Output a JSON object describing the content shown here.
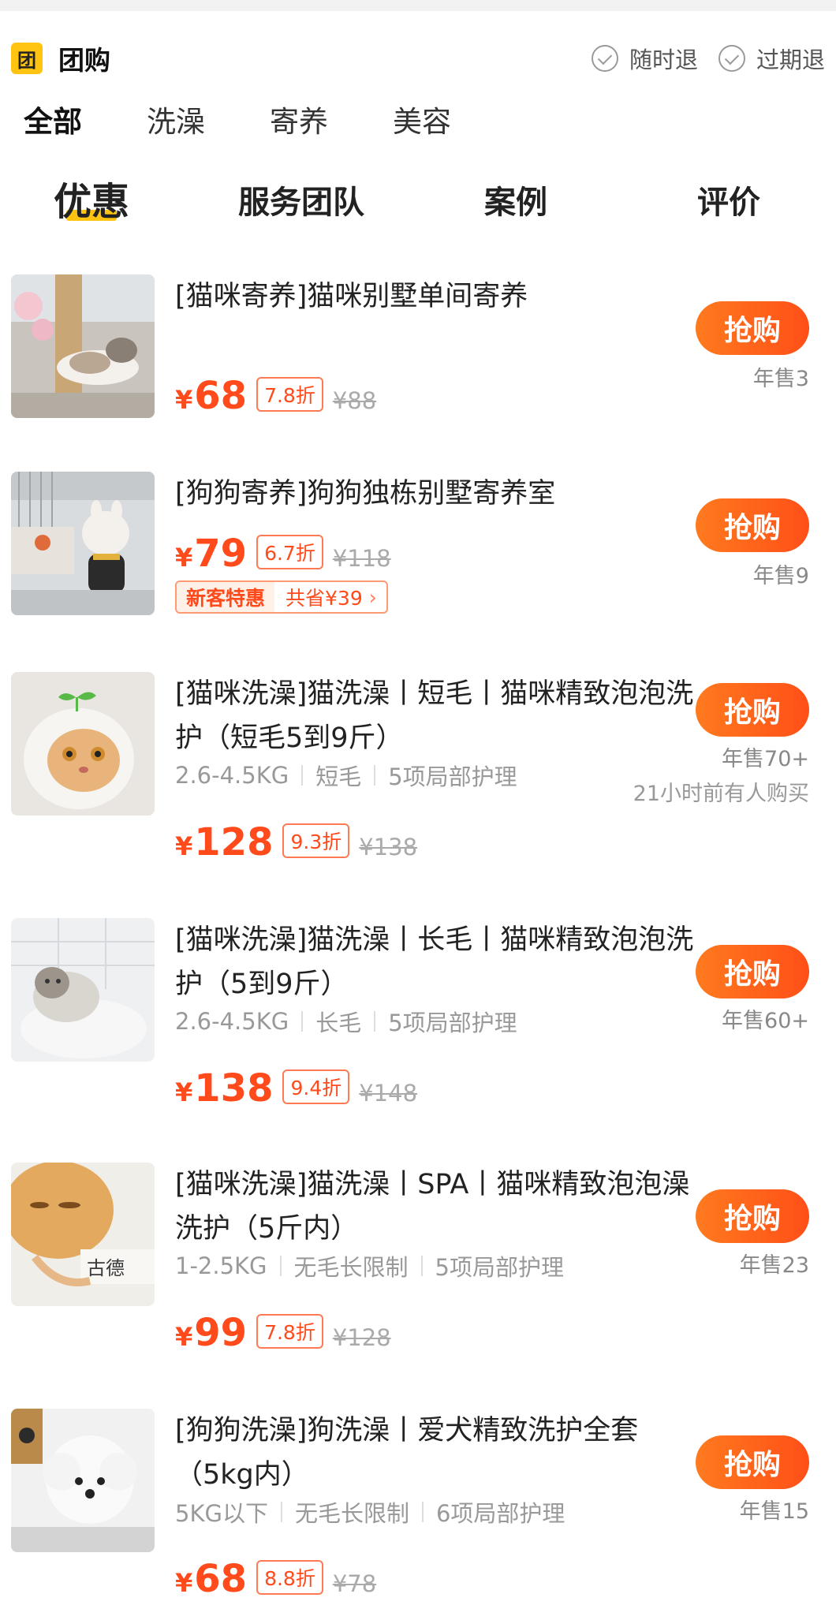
{
  "header": {
    "logo": "团",
    "title": "团购",
    "guarantees": [
      "随时退",
      "过期退"
    ]
  },
  "category_tabs": [
    "全部",
    "洗澡",
    "寄养",
    "美容"
  ],
  "section_tabs": [
    "优惠",
    "服务团队",
    "案例",
    "评价"
  ],
  "products": [
    {
      "title": "[猫咪寄养]猫咪别墅单间寄养",
      "specs": [],
      "price": "68",
      "currency": "¥",
      "discount": "7.8折",
      "original": "¥88",
      "buy_label": "抢购",
      "sales": "年售3",
      "thumb_icon": "cat-on-scratching-post-photo"
    },
    {
      "title": "[狗狗寄养]狗狗独栋别墅寄养室",
      "specs": [],
      "price": "79",
      "currency": "¥",
      "discount": "6.7折",
      "original": "¥118",
      "promo_tag": "新客特惠",
      "promo_save": "共省¥39",
      "promo_chevron": "›",
      "buy_label": "抢购",
      "sales": "年售9",
      "thumb_icon": "french-bulldog-photo"
    },
    {
      "title": "[猫咪洗澡]猫洗澡丨短毛丨猫咪精致泡泡洗护（短毛5到9斤）",
      "specs": [
        "2.6-4.5KG",
        "短毛",
        "5项局部护理"
      ],
      "price": "128",
      "currency": "¥",
      "discount": "9.3折",
      "original": "¥138",
      "buy_label": "抢购",
      "sales": "年售70+",
      "recent": "21小时前有人购买",
      "thumb_icon": "wet-cat-with-sprout-photo"
    },
    {
      "title": "[猫咪洗澡]猫洗澡丨长毛丨猫咪精致泡泡洗护（5到9斤）",
      "specs": [
        "2.6-4.5KG",
        "长毛",
        "5项局部护理"
      ],
      "price": "138",
      "currency": "¥",
      "discount": "9.4折",
      "original": "¥148",
      "buy_label": "抢购",
      "sales": "年售60+",
      "thumb_icon": "long-hair-cat-photo"
    },
    {
      "title": "[猫咪洗澡]猫洗澡丨SPA丨猫咪精致泡泡澡洗护（5斤内）",
      "specs": [
        "1-2.5KG",
        "无毛长限制",
        "5项局部护理"
      ],
      "price": "99",
      "currency": "¥",
      "discount": "7.8折",
      "original": "¥128",
      "buy_label": "抢购",
      "sales": "年售23",
      "thumb_icon": "cat-spa-photo"
    },
    {
      "title": "[狗狗洗澡]狗洗澡丨爱犬精致洗护全套（5kg内）",
      "specs": [
        "5KG以下",
        "无毛长限制",
        "6项局部护理"
      ],
      "price": "68",
      "currency": "¥",
      "discount": "8.8折",
      "original": "¥78",
      "buy_label": "抢购",
      "sales": "年售15",
      "thumb_icon": "white-poodle-photo"
    }
  ],
  "colors": {
    "accent": "#ff4a1c",
    "brand_yellow": "#ffc312",
    "button_gradient_start": "#ff7a1e",
    "button_gradient_end": "#ff4f18"
  }
}
